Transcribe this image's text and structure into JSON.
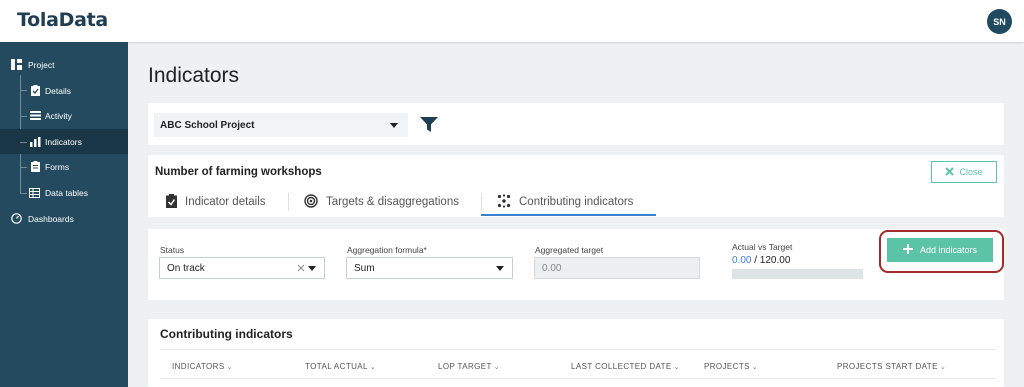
{
  "app": {
    "logo": "TolaData",
    "user_initials": "SN"
  },
  "sidebar": {
    "items": [
      {
        "label": "Project",
        "icon": "project-icon"
      },
      {
        "label": "Details",
        "icon": "clipboard-icon"
      },
      {
        "label": "Activity",
        "icon": "list-icon"
      },
      {
        "label": "Indicators",
        "icon": "bar-chart-icon",
        "active": true
      },
      {
        "label": "Forms",
        "icon": "form-icon"
      },
      {
        "label": "Data tables",
        "icon": "table-icon"
      },
      {
        "label": "Dashboards",
        "icon": "dashboard-icon"
      }
    ]
  },
  "page": {
    "title": "Indicators",
    "project_select": "ABC School Project",
    "filter_icon": "filter-icon"
  },
  "indicator": {
    "title": "Number of farming workshops",
    "close_label": "Close",
    "tabs": [
      {
        "label": "Indicator details",
        "icon": "clipboard-icon"
      },
      {
        "label": "Targets & disaggregations",
        "icon": "target-icon"
      },
      {
        "label": "Contributing indicators",
        "icon": "network-icon",
        "active": true
      }
    ]
  },
  "form": {
    "status_label": "Status",
    "status_value": "On track",
    "aggregation_label": "Aggregation formula*",
    "aggregation_value": "Sum",
    "aggregated_target_label": "Aggregated target",
    "aggregated_target_value": "0.00",
    "actual_vs_target_label": "Actual vs Target",
    "actual_value": "0.00",
    "target_value": " / 120.00",
    "progress_fraction": 0.0,
    "add_label": "Add indicators"
  },
  "contributing": {
    "title": "Contributing indicators",
    "columns": [
      "INDICATORS",
      "TOTAL ACTUAL",
      "LOP TARGET",
      "LAST COLLECTED DATE",
      "PROJECTS",
      "PROJECTS START DATE"
    ]
  },
  "colors": {
    "accent": "#5bc4a6",
    "sidebar": "#234a5e",
    "highlight": "#a52b2b",
    "link": "#3b7fd0"
  }
}
